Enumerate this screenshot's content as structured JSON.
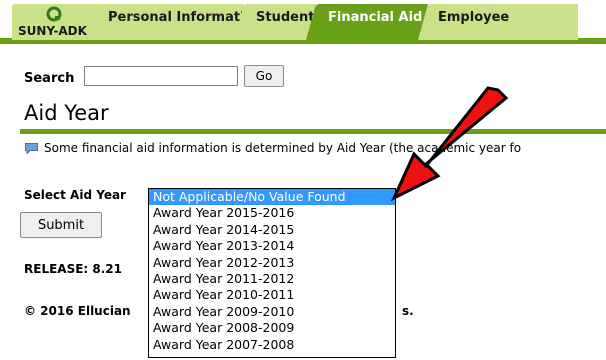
{
  "tabs": {
    "home": "SUNY-ADK",
    "personal": "Personal Information",
    "student": "Student",
    "financial_aid": "Financial Aid",
    "employee": "Employee"
  },
  "search": {
    "label": "Search",
    "value": "",
    "go": "Go"
  },
  "page": {
    "title": "Aid Year"
  },
  "info": {
    "icon": "info-flag-icon",
    "text": "Some financial aid information is determined by Aid Year (the academic year fo"
  },
  "form": {
    "select_label": "Select Aid Year",
    "submit": "Submit",
    "options": [
      "Not Applicable/No Value Found",
      "Award Year 2015-2016",
      "Award Year 2014-2015",
      "Award Year 2013-2014",
      "Award Year 2012-2013",
      "Award Year 2011-2012",
      "Award Year 2010-2011",
      "Award Year 2009-2010",
      "Award Year 2008-2009",
      "Award Year 2007-2008"
    ],
    "selected_index": 0
  },
  "footer": {
    "release": "RELEASE: 8.21",
    "copyright": "© 2016 Ellucian",
    "copyright_tail": "s."
  },
  "colors": {
    "accent_green": "#6a9f1a",
    "tab_light": "#c9e28a",
    "selection": "#3399ff",
    "arrow_red": "#ee1111"
  }
}
